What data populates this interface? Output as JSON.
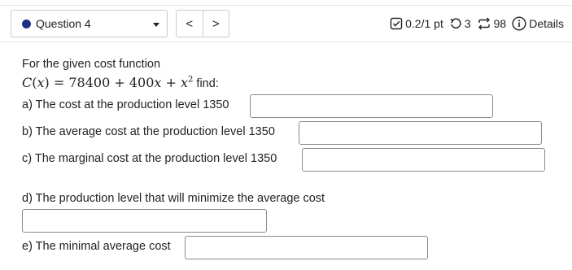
{
  "header": {
    "question_label": "Question 4",
    "prev_glyph": "<",
    "next_glyph": ">",
    "score": "0.2/1 pt",
    "retries": "3",
    "attempts": "98",
    "details_label": "Details",
    "icons": [
      "checkbox-icon",
      "retry-icon",
      "sync-icon",
      "info-icon"
    ]
  },
  "question": {
    "intro": "For the given cost function",
    "function_suffix": "find:",
    "parts": [
      {
        "label": "a) The cost at the production level 1350",
        "value": ""
      },
      {
        "label": "b) The average cost at the production level 1350",
        "value": ""
      },
      {
        "label": "c) The marginal cost at the production level 1350",
        "value": ""
      },
      {
        "label": "d) The production level that will minimize the average cost",
        "value": ""
      },
      {
        "label": "e) The minimal average cost",
        "value": ""
      }
    ]
  },
  "colors": {
    "accent_dot": "#1f2f87"
  }
}
